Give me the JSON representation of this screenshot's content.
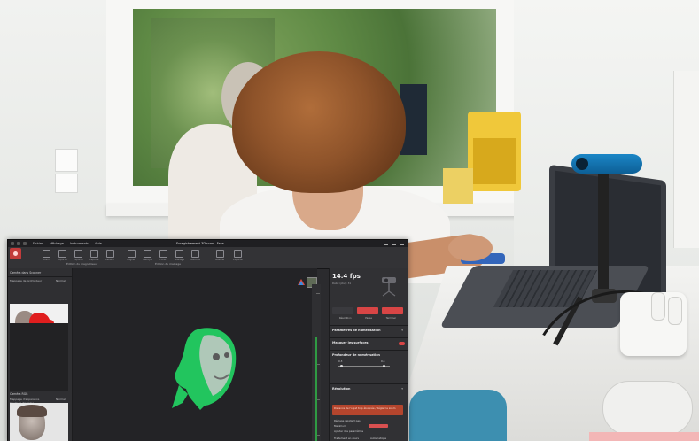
{
  "app": {
    "window_title": "Enregistrement 3D scan - Face",
    "menu": [
      "Fichier",
      "Affichage",
      "Instruments",
      "Aide"
    ],
    "ribbon": {
      "record_label": "Enregistrer",
      "tools": [
        "Ouvrir",
        "Importer",
        "Exporter",
        "Capture",
        "Calibrer",
        "Aligner",
        "Nettoyer",
        "Filtrer",
        "Maillage",
        "Textures",
        "Mesurer",
        "Exporter"
      ],
      "groups": [
        "Édition du magnétiseur",
        "Édition du maillage"
      ]
    },
    "left_panel": {
      "section1_title": "Caméra dans Scanner",
      "section1_row": "Mappage de profondeur",
      "section1_value": "Normal",
      "section2_title": "Caméra RGB",
      "section2_row1": "Mappage d'apparence",
      "section2_value": "Normal",
      "section2_row2": "Couleurs d'origine"
    },
    "right_panel": {
      "fps": "14.4 fps",
      "fps_sub": "Débit (pts) : 31",
      "btn_labels": [
        "Résolution",
        "Pause",
        "Terminer"
      ],
      "sections": [
        "Paramètres de numérisation",
        "Masquer les surfaces",
        "Profondeur de numérisation",
        "Résolution"
      ],
      "slider_min": "0.3",
      "slider_max": "0.8",
      "alert": "Distance de l'objet trop éloignée / Réglez le zoom",
      "rows": [
        "Réglage rapide 3 pas",
        "Maximum",
        "Ajouter des paramètres",
        "Traitement en cours"
      ],
      "chip_label": "Automatique"
    }
  },
  "colors": {
    "accent_red": "#d84545",
    "point_cloud_green": "#22c55e",
    "camera_blue": "#1b86c6"
  }
}
